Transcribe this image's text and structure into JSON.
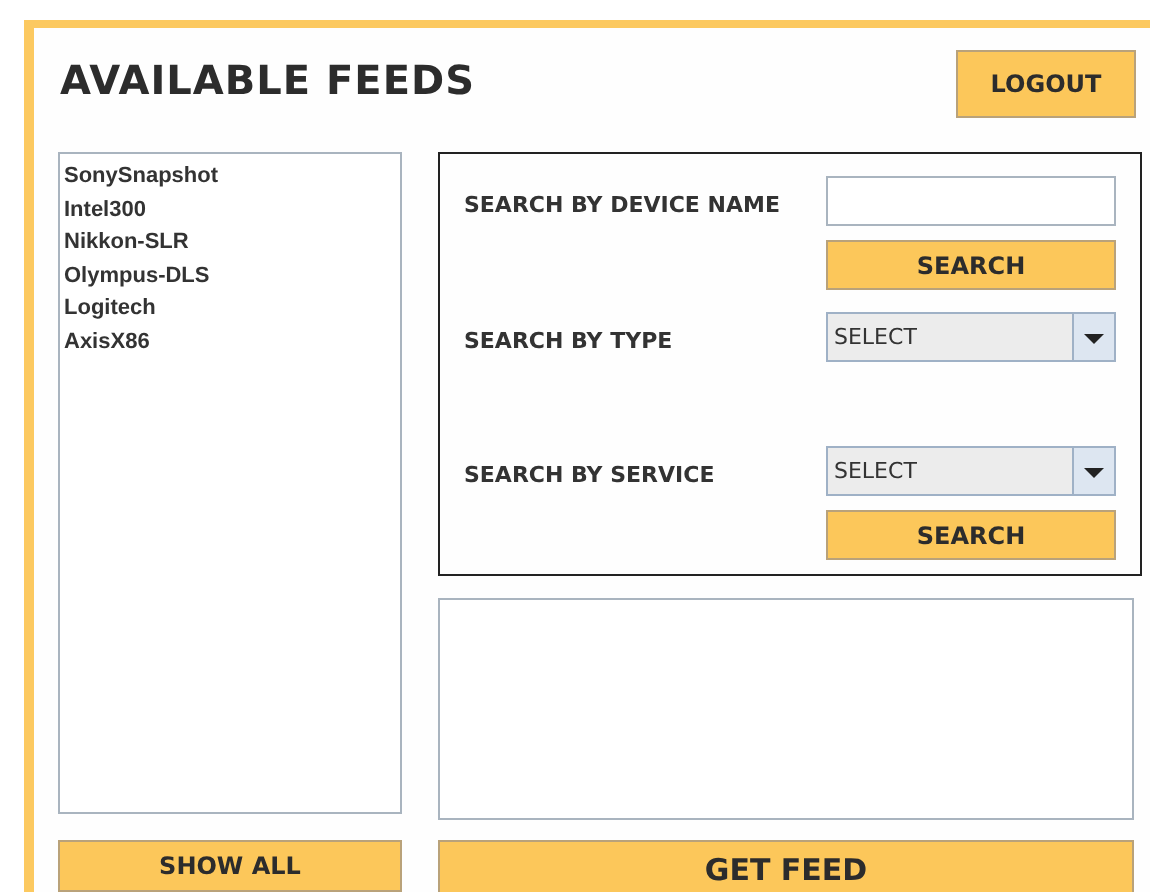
{
  "title": "AVAILABLE FEEDS",
  "logout_button": "LOGOUT",
  "feeds": [
    {
      "label": "SonySnapshot"
    },
    {
      "label": "Intel300"
    },
    {
      "label": "Nikkon-SLR"
    },
    {
      "label": "Olympus-DLS"
    },
    {
      "label": "Logitech"
    },
    {
      "label": "AxisX86"
    }
  ],
  "search_panel": {
    "rows": [
      {
        "kind": "text",
        "label": "SEARCH BY DEVICE NAME",
        "button": "SEARCH"
      },
      {
        "kind": "select",
        "label": "SEARCH BY TYPE",
        "value": "SELECT"
      },
      {
        "kind": "select",
        "label": "SEARCH BY SERVICE",
        "value": "SELECT",
        "button": "SEARCH"
      }
    ]
  },
  "show_all_button": "SHOW ALL",
  "get_feed_button": "GET FEED"
}
